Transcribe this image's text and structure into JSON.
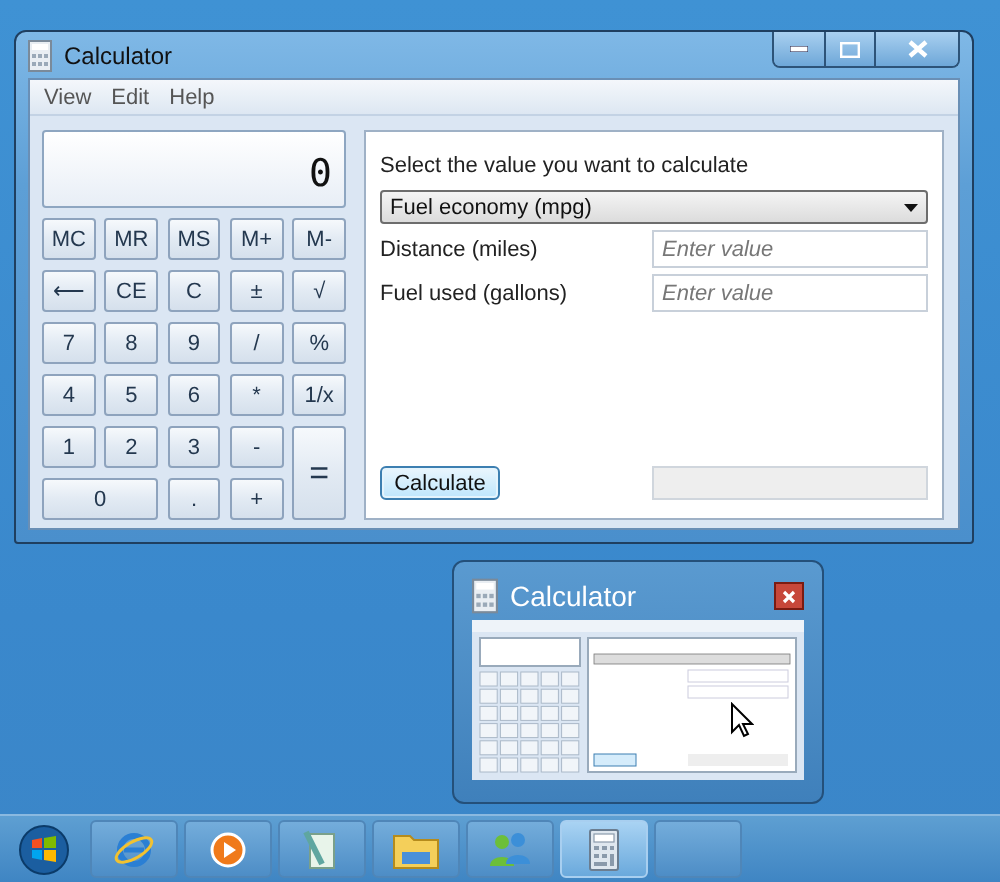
{
  "window": {
    "title": "Calculator"
  },
  "menu": [
    "View",
    "Edit",
    "Help"
  ],
  "display": {
    "value": "0"
  },
  "keys": [
    {
      "label": "MC",
      "kind": "key"
    },
    {
      "label": "MR",
      "kind": "key"
    },
    {
      "label": "MS",
      "kind": "key"
    },
    {
      "label": "M+",
      "kind": "key"
    },
    {
      "label": "M-",
      "kind": "key"
    },
    {
      "label": "⟵",
      "kind": "key"
    },
    {
      "label": "CE",
      "kind": "key"
    },
    {
      "label": "C",
      "kind": "key"
    },
    {
      "label": "±",
      "kind": "key"
    },
    {
      "label": "√",
      "kind": "key"
    },
    {
      "label": "7",
      "kind": "key"
    },
    {
      "label": "8",
      "kind": "key"
    },
    {
      "label": "9",
      "kind": "key"
    },
    {
      "label": "/",
      "kind": "key"
    },
    {
      "label": "%",
      "kind": "key"
    },
    {
      "label": "4",
      "kind": "key"
    },
    {
      "label": "5",
      "kind": "key"
    },
    {
      "label": "6",
      "kind": "key"
    },
    {
      "label": "*",
      "kind": "key"
    },
    {
      "label": "1/x",
      "kind": "key"
    },
    {
      "label": "1",
      "kind": "key"
    },
    {
      "label": "2",
      "kind": "key"
    },
    {
      "label": "3",
      "kind": "key"
    },
    {
      "label": "-",
      "kind": "key"
    },
    {
      "label": "=",
      "kind": "tall"
    },
    {
      "label": "0",
      "kind": "wide"
    },
    {
      "label": ".",
      "kind": "key"
    },
    {
      "label": "+",
      "kind": "key"
    }
  ],
  "converter": {
    "prompt": "Select the value you want to calculate",
    "selection": "Fuel economy (mpg)",
    "fields": [
      {
        "label": "Distance (miles)",
        "placeholder": "Enter value"
      },
      {
        "label": "Fuel used (gallons)",
        "placeholder": "Enter value"
      }
    ],
    "button": "Calculate"
  },
  "thumbnail": {
    "title": "Calculator"
  },
  "taskbar": [
    {
      "kind": "start",
      "selected": false
    },
    {
      "kind": "browser",
      "selected": false
    },
    {
      "kind": "media",
      "selected": false
    },
    {
      "kind": "notepad",
      "selected": false
    },
    {
      "kind": "folder",
      "selected": false
    },
    {
      "kind": "people",
      "selected": false
    },
    {
      "kind": "calculator",
      "selected": true
    },
    {
      "kind": "blank",
      "selected": false
    }
  ]
}
